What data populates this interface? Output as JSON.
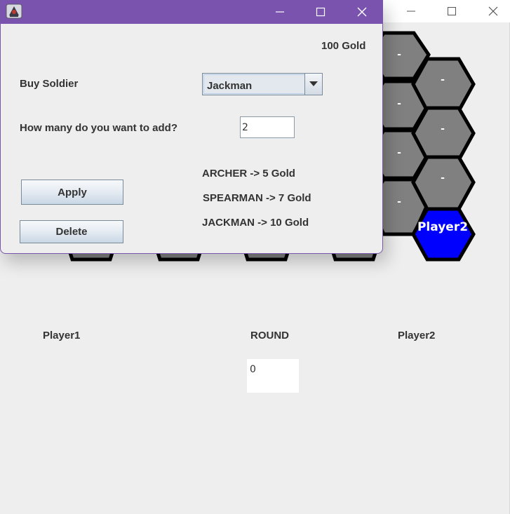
{
  "main_window": {
    "player1_label": "Player1",
    "round_label": "ROUND",
    "player2_label": "Player2",
    "round_value": "0"
  },
  "board": {
    "tile_marker": "-",
    "player2_tile_label": "Player2",
    "colors": {
      "empty_tile": "#808080",
      "player2_tile": "#0000ff",
      "tile_border": "#000000"
    }
  },
  "dialog": {
    "gold": "100 Gold",
    "buy_soldier_label": "Buy Soldier",
    "soldier_select": {
      "selected": "Jackman"
    },
    "quantity_label": "How many do you want to add?",
    "quantity_value": "2",
    "prices": [
      "ARCHER -> 5 Gold",
      "SPEARMAN -> 7 Gold",
      "JACKMAN -> 10 Gold"
    ],
    "apply_label": "Apply",
    "delete_label": "Delete",
    "titlebar_color": "#7a53ae"
  },
  "icons": {
    "app": "java-app-icon",
    "minimize": "minimize-icon",
    "maximize": "maximize-icon",
    "close": "close-icon",
    "dropdown": "chevron-down-icon"
  }
}
